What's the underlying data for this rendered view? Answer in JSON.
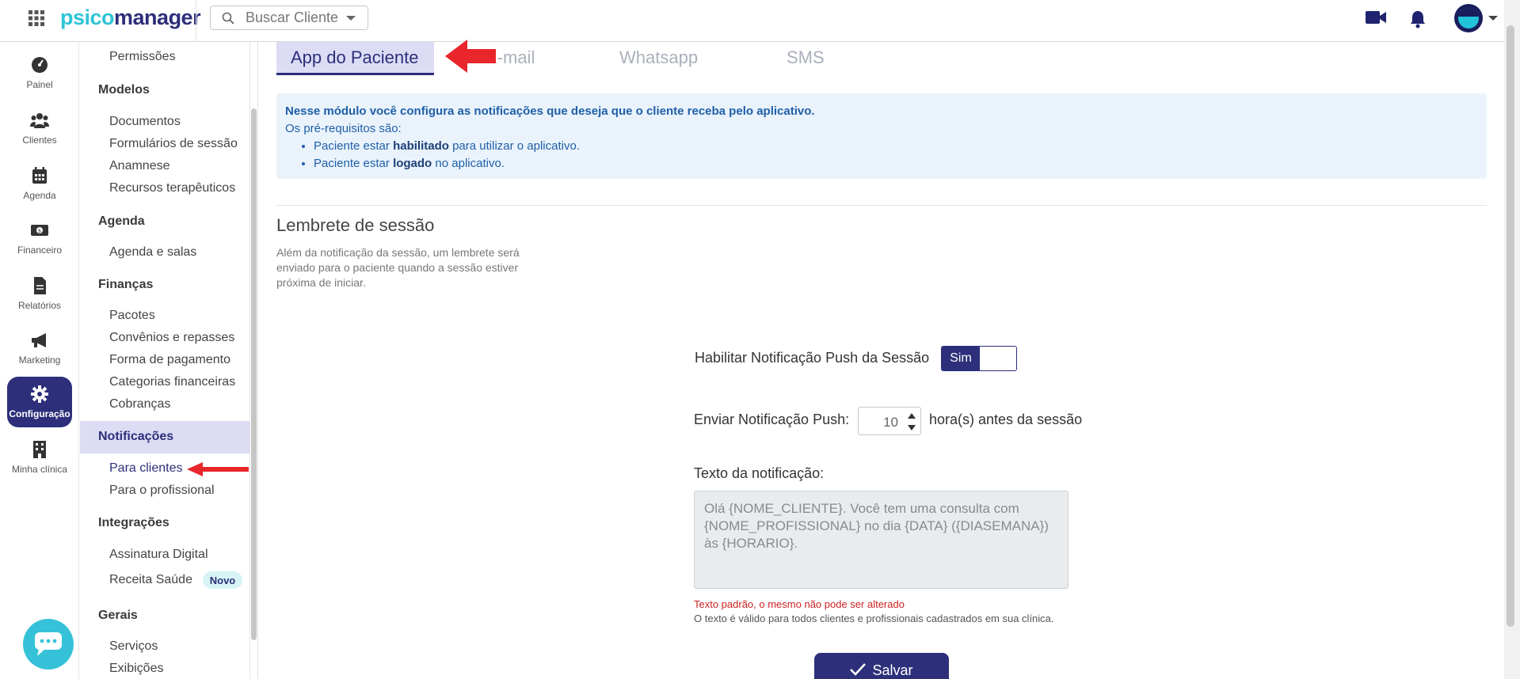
{
  "app": {
    "logo_part1": "psico",
    "logo_part2": "manager",
    "search_placeholder": "Buscar Cliente"
  },
  "rail": {
    "items": [
      {
        "label": "Painel",
        "icon": "dashboard-icon"
      },
      {
        "label": "Clientes",
        "icon": "users-icon"
      },
      {
        "label": "Agenda",
        "icon": "calendar-icon"
      },
      {
        "label": "Financeiro",
        "icon": "money-icon"
      },
      {
        "label": "Relatórios",
        "icon": "document-icon"
      },
      {
        "label": "Marketing",
        "icon": "megaphone-icon"
      },
      {
        "label": "Configuração",
        "icon": "gear-icon",
        "active": true
      },
      {
        "label": "Minha clínica",
        "icon": "building-icon"
      }
    ]
  },
  "menu": {
    "permissoes": "Permissões",
    "modelos": "Modelos",
    "documentos": "Documentos",
    "formularios": "Formulários de sessão",
    "anamnese": "Anamnese",
    "recursos": "Recursos terapêuticos",
    "agenda": "Agenda",
    "agenda_salas": "Agenda e salas",
    "financas": "Finanças",
    "pacotes": "Pacotes",
    "convenios": "Convênios e repasses",
    "forma_pagamento": "Forma de pagamento",
    "categorias": "Categorias financeiras",
    "cobrancas": "Cobranças",
    "notificacoes": "Notificações",
    "para_clientes": "Para clientes",
    "para_profissional": "Para o profissional",
    "integracoes": "Integrações",
    "assinatura": "Assinatura Digital",
    "receita": "Receita Saúde",
    "badge_novo": "Novo",
    "gerais": "Gerais",
    "servicos": "Serviços",
    "exibicoes": "Exibições"
  },
  "tabs": [
    "App do Paciente",
    "E-mail",
    "Whatsapp",
    "SMS"
  ],
  "info": {
    "line1": "Nesse módulo você configura as notificações que deseja que o cliente receba pelo aplicativo.",
    "line2": "Os pré-requisitos são:",
    "b1_pre": "Paciente estar ",
    "b1_bold": "habilitado",
    "b1_post": " para utilizar o aplicativo.",
    "b2_pre": "Paciente estar ",
    "b2_bold": "logado",
    "b2_post": " no aplicativo."
  },
  "section": {
    "title": "Lembrete de sessão",
    "description": "Além da notificação da sessão, um lembrete será enviado para o paciente quando a sessão estiver próxima de iniciar."
  },
  "form": {
    "push_label": "Habilitar Notificação Push da Sessão",
    "toggle_value": "Sim",
    "send_label": "Enviar Notificação Push:",
    "hours_value": "10",
    "hours_suffix": "hora(s) antes da sessão",
    "text_label": "Texto da notificação:",
    "text_value": "Olá {NOME_CLIENTE}. Você tem uma consulta com {NOME_PROFISSIONAL} no dia {DATA} ({DIASEMANA}) às {HORARIO}.",
    "note_red": "Texto padrão, o mesmo não pode ser alterado",
    "note_gray": "O texto é válido para todos clientes e profissionais cadastrados em sua clínica.",
    "save_label": "Salvar"
  },
  "colors": {
    "brand": "#2d2f7a",
    "accent": "#35c2d8",
    "info_bg": "#eaf3fc",
    "annotation_arrow": "#e8262c"
  }
}
